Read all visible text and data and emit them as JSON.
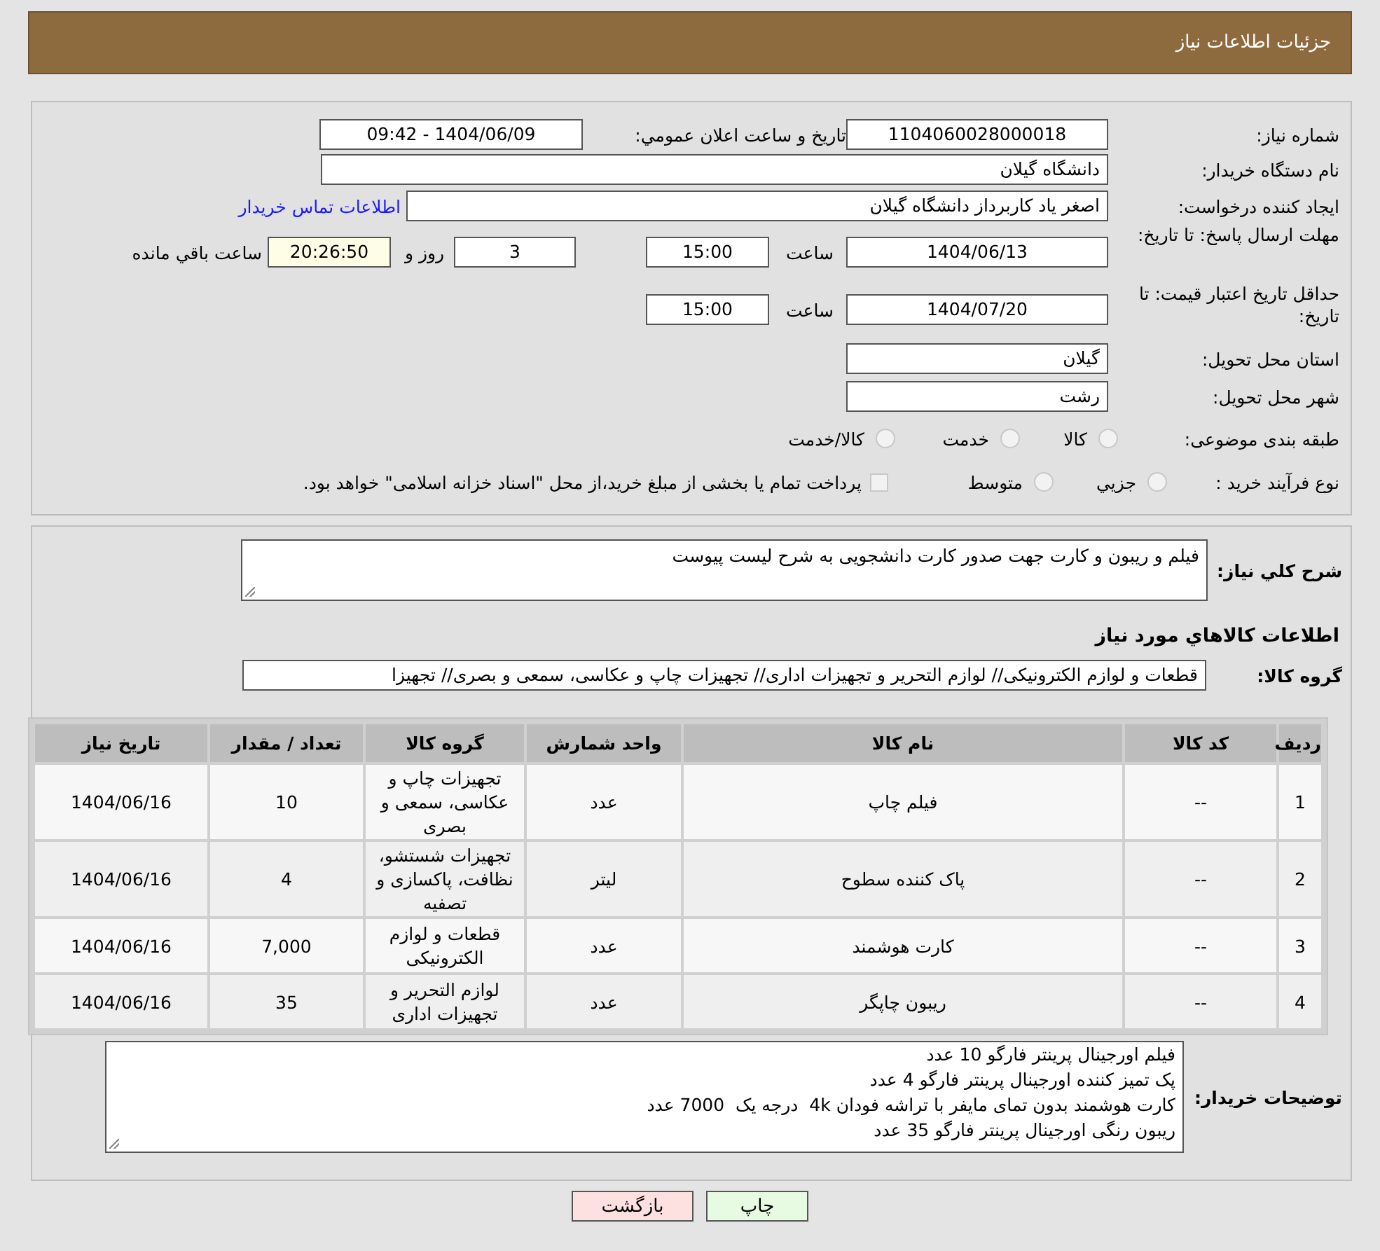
{
  "header": {
    "title": "جزئیات اطلاعات نیاز"
  },
  "need_number": {
    "label": "شماره نیاز:",
    "value": "1104060028000018"
  },
  "announce": {
    "label": "تاریخ و ساعت اعلان عمومي:",
    "value": "1404/06/09 - 09:42"
  },
  "buyer": {
    "label": "نام دستگاه خریدار:",
    "value": "دانشگاه گیلان"
  },
  "creator": {
    "label": "ایجاد کننده درخواست:",
    "value": "اصغر یاد کاربرداز دانشگاه گیلان",
    "link": "اطلاعات تماس خریدار"
  },
  "reply_deadline": {
    "label": "مهلت ارسال پاسخ: تا تاریخ:",
    "date": "1404/06/13",
    "time_label": "ساعت",
    "time": "15:00",
    "days": "3",
    "days_label": "روز و",
    "remaining": "20:26:50",
    "remaining_label": "ساعت باقي مانده"
  },
  "price_validity": {
    "label": "حداقل تاریخ اعتبار قیمت: تا تاریخ:",
    "date": "1404/07/20",
    "time_label": "ساعت",
    "time": "15:00"
  },
  "province": {
    "label": "استان محل تحویل:",
    "value": "گیلان"
  },
  "city": {
    "label": "شهر محل تحویل:",
    "value": "رشت"
  },
  "category": {
    "label": "طبقه بندی موضوعی:",
    "options": [
      {
        "label": "کالا",
        "selected": false
      },
      {
        "label": "خدمت",
        "selected": false
      },
      {
        "label": "کالا/خدمت",
        "selected": false
      }
    ]
  },
  "process": {
    "label": "نوع فرآیند خرید :",
    "options": [
      {
        "label": "جزيي",
        "selected": false
      },
      {
        "label": "متوسط",
        "selected": false
      }
    ],
    "treasury": {
      "checked": false,
      "label": "پرداخت تمام یا بخشی از مبلغ خرید،از محل \"اسناد خزانه اسلامی\" خواهد بود."
    }
  },
  "description": {
    "label": "شرح کلي نياز:",
    "value": "فیلم و ریبون و کارت جهت صدور کارت دانشجویی به شرح لیست پیوست"
  },
  "goods_heading": "اطلاعات کالاهاي مورد نياز",
  "goods_group": {
    "label": "گروه کالا:",
    "value": "قطعات و لوازم الکترونیکی// لوازم التحریر و تجهیزات اداری// تجهیزات چاپ و عکاسی، سمعی و بصری// تجهیزا"
  },
  "table": {
    "columns": [
      "ردیف",
      "کد کالا",
      "نام کالا",
      "واحد شمارش",
      "گروه کالا",
      "تعداد / مقدار",
      "تاریخ نیاز"
    ],
    "rows": [
      [
        "1",
        "--",
        "فیلم چاپ",
        "عدد",
        "تجهیزات چاپ و عکاسی، سمعی و بصری",
        "10",
        "1404/06/16"
      ],
      [
        "2",
        "--",
        "پاک کننده سطوح",
        "لیتر",
        "تجهیزات شستشو، نظافت، پاکسازی و تصفیه",
        "4",
        "1404/06/16"
      ],
      [
        "3",
        "--",
        "کارت هوشمند",
        "عدد",
        "قطعات و لوازم الکترونیکی",
        "7,000",
        "1404/06/16"
      ],
      [
        "4",
        "--",
        "ریبون چاپگر",
        "عدد",
        "لوازم التحریر و تجهیزات اداری",
        "35",
        "1404/06/16"
      ]
    ]
  },
  "buyer_notes": {
    "label": "توضیحات خریدار:",
    "lines": [
      "فیلم اورجینال پرینتر فارگو 10 عدد",
      "پک تمیز کننده اورجینال پرینتر فارگو 4 عدد",
      "کارت هوشمند بدون تمای مایفر با تراشه فودان 4k  درجه یک  7000 عدد",
      "ریبون رنگی اورجینال پرینتر فارگو 35 عدد"
    ]
  },
  "buttons": [
    {
      "kind": "print",
      "label": "چاپ"
    },
    {
      "kind": "back",
      "label": "بازگشت"
    }
  ]
}
